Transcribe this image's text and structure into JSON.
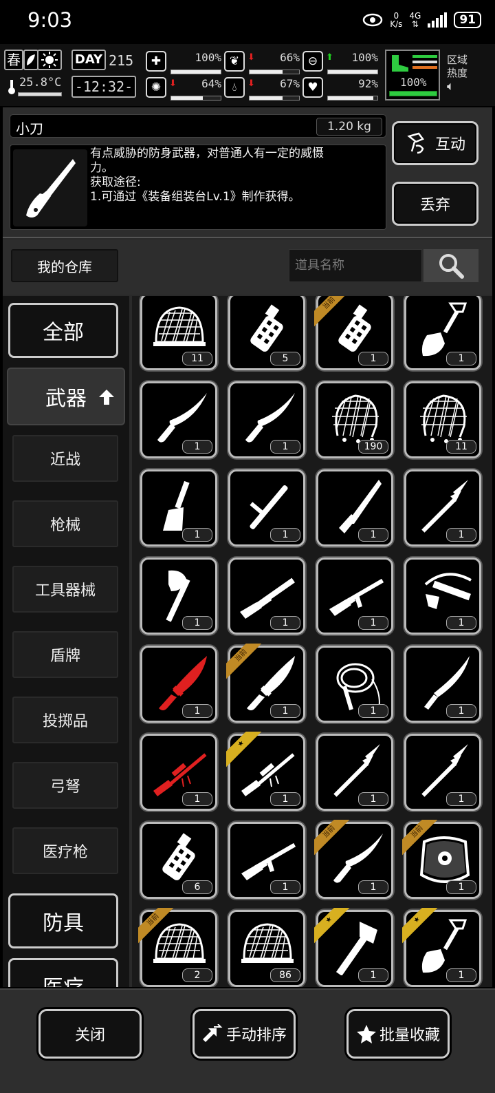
{
  "status_bar": {
    "time": "9:03",
    "net_speed_value": "0",
    "net_speed_unit": "K/s",
    "network": "4G",
    "battery": "91"
  },
  "hud": {
    "season": "春",
    "temperature": "25.8°C",
    "day_label": "DAY",
    "day_value": "215",
    "clock": "-12:32-",
    "stats": [
      {
        "icon": "first-aid-icon",
        "value": "100%",
        "arrow": "",
        "level": 1.0
      },
      {
        "icon": "stomach-icon",
        "value": "66%",
        "arrow": "down",
        "level": 0.66
      },
      {
        "icon": "lungs-icon",
        "value": "100%",
        "arrow": "up",
        "level": 1.0
      },
      {
        "icon": "brain-icon",
        "value": "64%",
        "arrow": "down",
        "level": 0.64
      },
      {
        "icon": "water-drop-icon",
        "value": "67%",
        "arrow": "down",
        "level": 0.67
      },
      {
        "icon": "heart-icon",
        "value": "92%",
        "arrow": "",
        "level": 0.92
      }
    ],
    "stamina": "100%",
    "region_label_1": "区域",
    "region_label_2": "热度"
  },
  "item_detail": {
    "name": "小刀",
    "weight": "1.20 kg",
    "description": "有点威胁的防身武器，对普通人有一定的威慑\n力。\n获取途径:\n1.可通过《装备组装台Lv.1》制作获得。",
    "interact_label": "互动",
    "discard_label": "丢弃"
  },
  "storage": {
    "tab_label": "我的仓库",
    "search_placeholder": "道具名称"
  },
  "sidebar": {
    "all": "全部",
    "weapons": "武器",
    "sub": [
      "近战",
      "枪械",
      "工具器械",
      "盾牌",
      "投掷品",
      "弓弩",
      "医疗枪"
    ],
    "armor": "防具",
    "medical": "医疗"
  },
  "tag_text": "当前",
  "items": [
    {
      "icon": "net-helmet-icon",
      "count": "11",
      "tag": ""
    },
    {
      "icon": "grenade-icon",
      "count": "5",
      "tag": ""
    },
    {
      "icon": "grenade-icon",
      "count": "1",
      "tag": "current"
    },
    {
      "icon": "shovel-icon",
      "count": "1",
      "tag": ""
    },
    {
      "icon": "machete-icon",
      "count": "1",
      "tag": ""
    },
    {
      "icon": "machete-icon",
      "count": "1",
      "tag": ""
    },
    {
      "icon": "net-icon",
      "count": "190",
      "tag": ""
    },
    {
      "icon": "net-icon",
      "count": "11",
      "tag": ""
    },
    {
      "icon": "chisel-icon",
      "count": "1",
      "tag": ""
    },
    {
      "icon": "baton-icon",
      "count": "1",
      "tag": ""
    },
    {
      "icon": "folding-knife-icon",
      "count": "1",
      "tag": ""
    },
    {
      "icon": "spear-icon",
      "count": "1",
      "tag": ""
    },
    {
      "icon": "axe-icon",
      "count": "1",
      "tag": ""
    },
    {
      "icon": "shotgun-icon",
      "count": "1",
      "tag": ""
    },
    {
      "icon": "rifle-icon",
      "count": "1",
      "tag": ""
    },
    {
      "icon": "crossbow-icon",
      "count": "1",
      "tag": ""
    },
    {
      "icon": "combat-knife-icon",
      "count": "1",
      "tag": "",
      "color": "#e02020"
    },
    {
      "icon": "combat-knife-icon",
      "count": "1",
      "tag": "current"
    },
    {
      "icon": "whip-icon",
      "count": "1",
      "tag": ""
    },
    {
      "icon": "sword-icon",
      "count": "1",
      "tag": ""
    },
    {
      "icon": "sniper-rifle-icon",
      "count": "1",
      "tag": "",
      "color": "#e02020"
    },
    {
      "icon": "sniper-rifle-icon",
      "count": "1",
      "tag": "star"
    },
    {
      "icon": "spear-icon",
      "count": "1",
      "tag": ""
    },
    {
      "icon": "spear-icon",
      "count": "1",
      "tag": ""
    },
    {
      "icon": "grenade-icon",
      "count": "6",
      "tag": ""
    },
    {
      "icon": "rifle-icon",
      "count": "1",
      "tag": ""
    },
    {
      "icon": "machete-icon",
      "count": "1",
      "tag": "current"
    },
    {
      "icon": "shield-icon",
      "count": "1",
      "tag": "current"
    },
    {
      "icon": "net-helmet-icon",
      "count": "2",
      "tag": "current"
    },
    {
      "icon": "net-helmet-icon",
      "count": "86",
      "tag": ""
    },
    {
      "icon": "hatchet-icon",
      "count": "1",
      "tag": "star"
    },
    {
      "icon": "shovel-icon",
      "count": "1",
      "tag": "star"
    }
  ],
  "bottom": {
    "close": "关闭",
    "manual_sort": "手动排序",
    "batch_favorite": "批量收藏"
  }
}
